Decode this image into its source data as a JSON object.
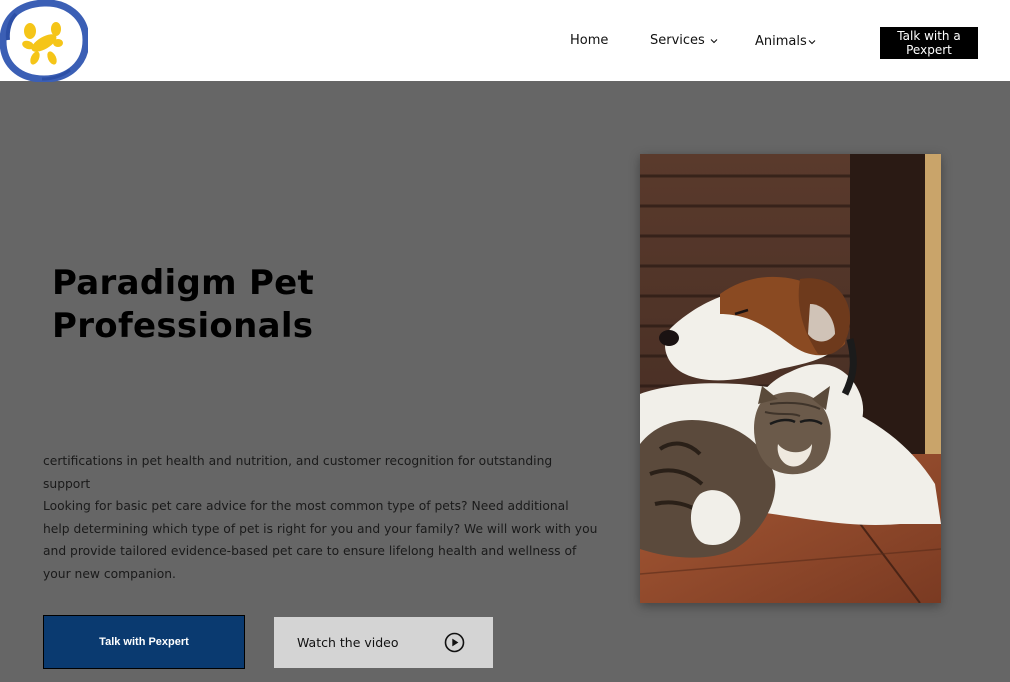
{
  "header": {
    "logo": {
      "icon": "balloon-dog-logo",
      "ring_color": "#3b5fb5",
      "dog_color": "#f5c518"
    },
    "nav": [
      {
        "label": "Home",
        "has_dropdown": false
      },
      {
        "label": "Services",
        "has_dropdown": true
      },
      {
        "label": "Animals",
        "has_dropdown": true
      }
    ],
    "cta": {
      "line1": "Talk with a",
      "line2": "Pexpert"
    }
  },
  "hero": {
    "title_line1": "Paradigm Pet",
    "title_line2": "Professionals",
    "paragraph1": "certifications in pet health and nutrition, and customer recognition for outstanding support",
    "paragraph2": "Looking for basic pet care advice for the most common type of pets? Need additional help determining which type of pet is right for you and your family? We will work with you and provide tailored evidence-based pet care to ensure lifelong health and wellness of your new companion.",
    "primary_button": "Talk with Pexpert",
    "secondary_button": "Watch the video",
    "secondary_icon": "play-circle-icon",
    "image": "dog-and-cat-photo"
  },
  "colors": {
    "background": "#666666",
    "header": "#ffffff",
    "primary_button": "#0a3a70",
    "secondary_button": "#d4d4d4"
  }
}
